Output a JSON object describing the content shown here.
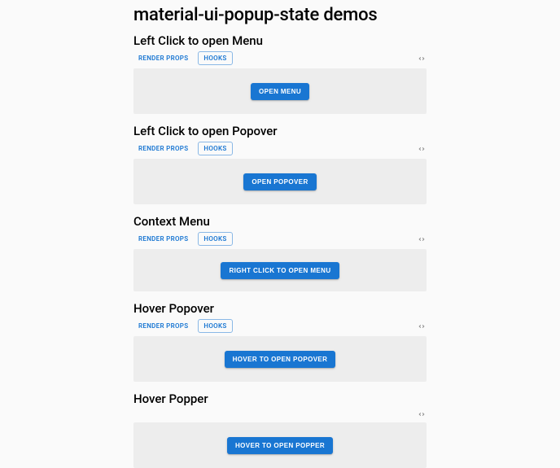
{
  "page_title": "material-ui-popup-state demos",
  "tab_labels": {
    "render_props": "RENDER PROPS",
    "hooks": "HOOKS"
  },
  "sections": [
    {
      "heading": "Left Click to open Menu",
      "button_label": "OPEN MENU",
      "show_tabs": true
    },
    {
      "heading": "Left Click to open Popover",
      "button_label": "OPEN POPOVER",
      "show_tabs": true
    },
    {
      "heading": "Context Menu",
      "button_label": "RIGHT CLICK TO OPEN MENU",
      "show_tabs": true
    },
    {
      "heading": "Hover Popover",
      "button_label": "HOVER TO OPEN POPOVER",
      "show_tabs": true
    },
    {
      "heading": "Hover Popper",
      "button_label": "HOVER TO OPEN POPPER",
      "show_tabs": false
    }
  ]
}
